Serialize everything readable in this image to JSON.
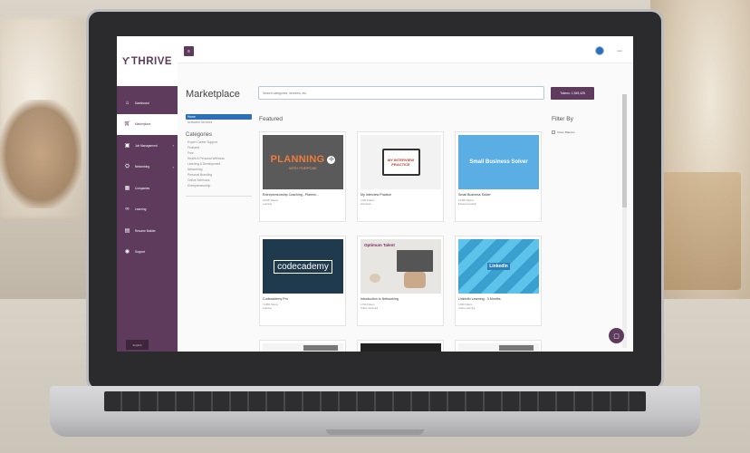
{
  "app": {
    "logo_text": "THRIVE"
  },
  "sidebar": {
    "items": [
      {
        "label": "Dashboard",
        "icon": "home-icon",
        "active": false,
        "caret": false
      },
      {
        "label": "Marketplace",
        "icon": "cart-icon",
        "active": true,
        "caret": false
      },
      {
        "label": "Job Management",
        "icon": "briefcase-icon",
        "active": false,
        "caret": true
      },
      {
        "label": "Networking",
        "icon": "network-icon",
        "active": false,
        "caret": true
      },
      {
        "label": "Companies",
        "icon": "building-icon",
        "active": false,
        "caret": false
      },
      {
        "label": "Learning",
        "icon": "glasses-icon",
        "active": false,
        "caret": false
      },
      {
        "label": "Resume Builder",
        "icon": "document-icon",
        "active": false,
        "caret": false
      },
      {
        "label": "Support",
        "icon": "support-icon",
        "active": false,
        "caret": false
      }
    ],
    "footer_label": "English"
  },
  "topbar": {
    "user_name": "user"
  },
  "main": {
    "page_title": "Marketplace",
    "search_placeholder": "Search categories, services, etc.",
    "tokens_label": "Tokens: 1,545,425",
    "left_menu": {
      "home": "Home",
      "activated": "Activated Services"
    },
    "categories_heading": "Categories",
    "categories": [
      "Expert Career Support",
      "Featured",
      "Free",
      "Health & Personal Wellness",
      "Learning & Development",
      "Networking",
      "Personal Branding",
      "Online Seminars",
      "Entrepreneurship"
    ],
    "featured_label": "Featured",
    "filter_label": "Filter By",
    "filter_option": "Token Balance",
    "cards": [
      {
        "title": "Entrepreneurship Coaching - Plannin...",
        "meta1": "46,000 Tokens",
        "meta2": "Learning",
        "image_text": "PLANNING",
        "image_subtext": "WITH PURPOSE"
      },
      {
        "title": "My Interview Practice",
        "meta1": "4,000 Tokens",
        "meta2": "Interviews",
        "image_text": "MY INTERVIEW PRACTICE"
      },
      {
        "title": "Small Business Solver",
        "meta1": "16,980 Tokens",
        "meta2": "Entrepreneurship",
        "image_text": "Small Business Solver"
      },
      {
        "title": "Codecademy Pro",
        "meta1": "71,880 Tokens",
        "meta2": "Learning",
        "image_text": "codecademy"
      },
      {
        "title": "Introduction to Networking",
        "meta1": "2,700 Tokens",
        "meta2": "Online Seminars",
        "image_text": "Optimum Talent"
      },
      {
        "title": "LinkedIn Learning - 3 Months",
        "meta1": "4,680 Tokens",
        "meta2": "Online Learning",
        "image_text": "LinkedIn"
      },
      {
        "title": "",
        "meta1": "",
        "meta2": ""
      },
      {
        "title": "",
        "meta1": "",
        "meta2": ""
      },
      {
        "title": "",
        "meta1": "",
        "meta2": ""
      }
    ]
  }
}
